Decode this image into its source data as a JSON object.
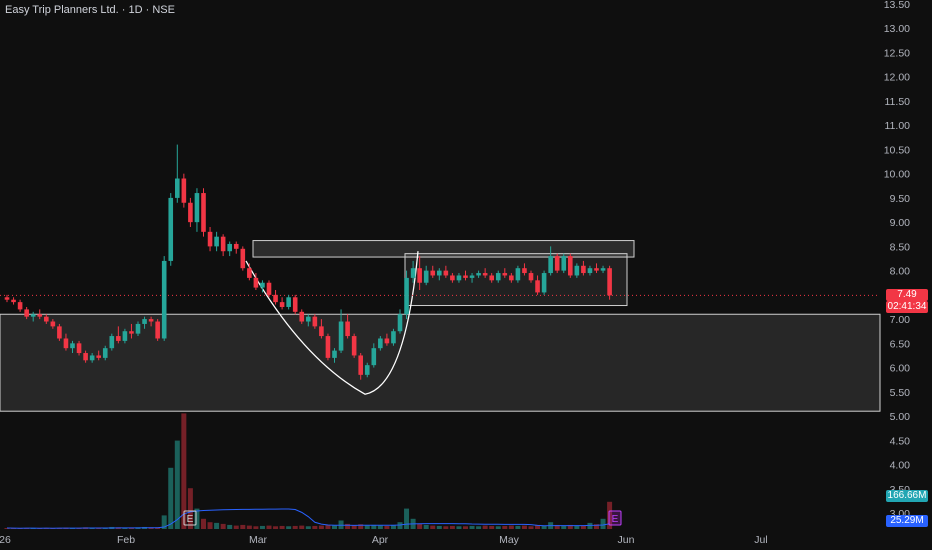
{
  "header": {
    "title": "Easy Trip Planners Ltd. · 1D · NSE"
  },
  "price_axis": {
    "ticks": [
      "13.50",
      "13.00",
      "12.50",
      "12.00",
      "11.50",
      "11.00",
      "10.50",
      "10.00",
      "9.50",
      "9.00",
      "8.50",
      "8.00",
      "7.50",
      "7.00",
      "6.50",
      "6.00",
      "5.50",
      "5.00",
      "4.50",
      "4.00",
      "3.50",
      "3.00"
    ]
  },
  "time_axis": {
    "labels": [
      "26",
      "Feb",
      "Mar",
      "Apr",
      "May",
      "Jun",
      "Jul"
    ]
  },
  "last_price": {
    "value": "7.49",
    "countdown": "02:41:34"
  },
  "volume": {
    "value": "166.66M",
    "ma_value": "25.29M"
  },
  "event_markers": [
    "E",
    "E"
  ],
  "colors": {
    "up": "#26a69a",
    "down": "#f23645",
    "background": "#0f0f0f",
    "volume_ma": "#2962ff",
    "zone": "#ffffff"
  },
  "chart_data": {
    "type": "candlestick",
    "title": "Easy Trip Planners Ltd. · 1D · NSE",
    "ylim": [
      3.0,
      13.5
    ],
    "x_labels": [
      "Feb",
      "Mar",
      "Apr",
      "May",
      "Jun",
      "Jul"
    ],
    "candles": [
      [
        7.45,
        7.5,
        7.35,
        7.4
      ],
      [
        7.4,
        7.45,
        7.3,
        7.35
      ],
      [
        7.35,
        7.4,
        7.15,
        7.2
      ],
      [
        7.2,
        7.25,
        7.0,
        7.05
      ],
      [
        7.05,
        7.15,
        6.95,
        7.1
      ],
      [
        7.1,
        7.2,
        7.0,
        7.05
      ],
      [
        7.05,
        7.1,
        6.9,
        6.95
      ],
      [
        6.95,
        7.0,
        6.8,
        6.85
      ],
      [
        6.85,
        6.9,
        6.55,
        6.6
      ],
      [
        6.6,
        6.7,
        6.35,
        6.4
      ],
      [
        6.4,
        6.55,
        6.3,
        6.5
      ],
      [
        6.5,
        6.55,
        6.25,
        6.3
      ],
      [
        6.3,
        6.35,
        6.1,
        6.15
      ],
      [
        6.15,
        6.3,
        6.1,
        6.25
      ],
      [
        6.25,
        6.35,
        6.15,
        6.2
      ],
      [
        6.2,
        6.45,
        6.15,
        6.4
      ],
      [
        6.4,
        6.7,
        6.35,
        6.65
      ],
      [
        6.65,
        6.85,
        6.5,
        6.55
      ],
      [
        6.55,
        6.8,
        6.5,
        6.75
      ],
      [
        6.75,
        6.9,
        6.6,
        6.7
      ],
      [
        6.7,
        6.95,
        6.65,
        6.9
      ],
      [
        6.9,
        7.05,
        6.8,
        7.0
      ],
      [
        7.0,
        7.05,
        6.85,
        6.95
      ],
      [
        6.95,
        7.0,
        6.55,
        6.6
      ],
      [
        6.6,
        8.3,
        6.55,
        8.2
      ],
      [
        8.2,
        9.6,
        8.1,
        9.5
      ],
      [
        9.5,
        10.6,
        9.4,
        9.9
      ],
      [
        9.9,
        10.0,
        9.3,
        9.4
      ],
      [
        9.4,
        9.5,
        8.9,
        9.0
      ],
      [
        9.0,
        9.7,
        8.8,
        9.6
      ],
      [
        9.6,
        9.7,
        8.7,
        8.8
      ],
      [
        8.8,
        8.9,
        8.4,
        8.5
      ],
      [
        8.5,
        8.8,
        8.4,
        8.7
      ],
      [
        8.7,
        8.75,
        8.3,
        8.4
      ],
      [
        8.4,
        8.6,
        8.3,
        8.55
      ],
      [
        8.55,
        8.6,
        8.35,
        8.45
      ],
      [
        8.45,
        8.5,
        8.0,
        8.05
      ],
      [
        8.05,
        8.15,
        7.8,
        7.85
      ],
      [
        7.85,
        7.95,
        7.6,
        7.65
      ],
      [
        7.65,
        7.8,
        7.55,
        7.75
      ],
      [
        7.75,
        7.8,
        7.45,
        7.5
      ],
      [
        7.5,
        7.6,
        7.3,
        7.35
      ],
      [
        7.35,
        7.45,
        7.2,
        7.25
      ],
      [
        7.25,
        7.5,
        7.2,
        7.45
      ],
      [
        7.45,
        7.5,
        7.1,
        7.15
      ],
      [
        7.15,
        7.2,
        6.9,
        6.95
      ],
      [
        6.95,
        7.1,
        6.85,
        7.05
      ],
      [
        7.05,
        7.1,
        6.8,
        6.85
      ],
      [
        6.85,
        7.0,
        6.6,
        6.65
      ],
      [
        6.65,
        6.7,
        6.15,
        6.2
      ],
      [
        6.2,
        6.4,
        6.1,
        6.35
      ],
      [
        6.35,
        7.2,
        6.3,
        6.95
      ],
      [
        6.95,
        7.1,
        6.6,
        6.65
      ],
      [
        6.65,
        6.7,
        6.2,
        6.25
      ],
      [
        6.25,
        6.3,
        5.75,
        5.85
      ],
      [
        5.85,
        6.1,
        5.8,
        6.05
      ],
      [
        6.05,
        6.5,
        6.0,
        6.4
      ],
      [
        6.4,
        6.65,
        6.35,
        6.6
      ],
      [
        6.6,
        6.7,
        6.45,
        6.5
      ],
      [
        6.5,
        6.8,
        6.45,
        6.75
      ],
      [
        6.75,
        7.2,
        6.7,
        7.1
      ],
      [
        7.1,
        8.0,
        7.0,
        7.85
      ],
      [
        7.85,
        8.2,
        7.75,
        8.05
      ],
      [
        8.05,
        8.3,
        7.6,
        7.75
      ],
      [
        7.75,
        8.1,
        7.7,
        8.0
      ],
      [
        8.0,
        8.1,
        7.85,
        7.9
      ],
      [
        7.9,
        8.05,
        7.8,
        8.0
      ],
      [
        8.0,
        8.1,
        7.85,
        7.9
      ],
      [
        7.9,
        7.95,
        7.75,
        7.8
      ],
      [
        7.8,
        7.95,
        7.75,
        7.9
      ],
      [
        7.9,
        8.0,
        7.8,
        7.85
      ],
      [
        7.85,
        7.95,
        7.75,
        7.9
      ],
      [
        7.9,
        8.0,
        7.85,
        7.95
      ],
      [
        7.95,
        8.05,
        7.85,
        7.9
      ],
      [
        7.9,
        7.95,
        7.75,
        7.8
      ],
      [
        7.8,
        8.0,
        7.75,
        7.95
      ],
      [
        7.95,
        8.05,
        7.85,
        7.9
      ],
      [
        7.9,
        7.95,
        7.75,
        7.8
      ],
      [
        7.8,
        8.1,
        7.75,
        8.05
      ],
      [
        8.05,
        8.15,
        7.9,
        7.95
      ],
      [
        7.95,
        8.0,
        7.75,
        7.8
      ],
      [
        7.8,
        7.9,
        7.5,
        7.55
      ],
      [
        7.55,
        8.0,
        7.5,
        7.95
      ],
      [
        7.95,
        8.5,
        7.9,
        8.3
      ],
      [
        8.3,
        8.35,
        7.95,
        8.0
      ],
      [
        8.0,
        8.35,
        7.95,
        8.3
      ],
      [
        8.3,
        8.35,
        7.85,
        7.9
      ],
      [
        7.9,
        8.15,
        7.85,
        8.1
      ],
      [
        8.1,
        8.2,
        7.9,
        7.95
      ],
      [
        7.95,
        8.1,
        7.9,
        8.05
      ],
      [
        8.05,
        8.15,
        7.95,
        8.0
      ],
      [
        8.0,
        8.1,
        7.95,
        8.05
      ],
      [
        8.05,
        8.1,
        7.4,
        7.49
      ]
    ],
    "volume_millions": [
      3,
      2,
      2,
      3,
      2,
      2,
      3,
      2,
      3,
      4,
      3,
      3,
      5,
      3,
      3,
      4,
      6,
      5,
      4,
      4,
      5,
      6,
      5,
      5,
      40,
      180,
      260,
      340,
      120,
      60,
      30,
      20,
      18,
      15,
      12,
      10,
      12,
      10,
      8,
      9,
      10,
      8,
      9,
      8,
      9,
      10,
      8,
      9,
      10,
      12,
      10,
      25,
      15,
      12,
      14,
      10,
      12,
      10,
      9,
      12,
      20,
      60,
      30,
      15,
      12,
      10,
      9,
      8,
      9,
      8,
      8,
      9,
      8,
      10,
      9,
      8,
      9,
      10,
      9,
      10,
      8,
      12,
      10,
      20,
      12,
      10,
      12,
      9,
      10,
      18,
      14,
      30,
      80
    ]
  }
}
